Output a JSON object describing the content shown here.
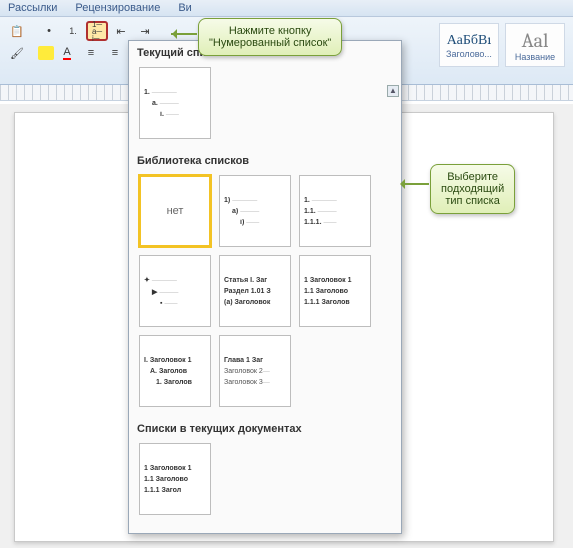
{
  "ribbon_tabs": [
    "Рассылки",
    "Рецензирование",
    "Ви"
  ],
  "callouts": {
    "press_button": {
      "line1": "Нажмите кнопку",
      "line2": "\"Нумерованный список\""
    },
    "choose_type": {
      "line1": "Выберите",
      "line2": "подходящий",
      "line3": "тип списка"
    }
  },
  "styles": {
    "s1": {
      "preview": "АаБбВı",
      "name": "Заголово..."
    },
    "s2": {
      "preview": "Aal",
      "name": "Название"
    }
  },
  "dropdown": {
    "section_current": "Текущий список",
    "section_library": "Библиотека списков",
    "section_docs": "Списки в текущих документах",
    "none_label": "нет",
    "current_tile": {
      "l1": "1.",
      "l2": "a.",
      "l3": "i."
    },
    "lib": {
      "r1c2": {
        "l1": "1)",
        "l2": "a)",
        "l3": "i)"
      },
      "r1c3": {
        "l1": "1.",
        "l2": "1.1.",
        "l3": "1.1.1."
      },
      "r2c1": {
        "l1": "✦",
        "l2": "▶",
        "l3": "▪"
      },
      "r2c2": {
        "l1": "Статья I. Заг",
        "l2": "Раздел 1.01 З",
        "l3": "(a) Заголовок"
      },
      "r2c3": {
        "l1": "1 Заголовок 1",
        "l2": "1.1 Заголово",
        "l3": "1.1.1 Заголов"
      },
      "r3c1": {
        "l1": "I. Заголовок 1",
        "l2": "A. Заголов",
        "l3": "1. Заголов"
      },
      "r3c2": {
        "l1": "Глава 1 Заг",
        "l2": "Заголовок 2",
        "l3": "Заголовок 3"
      }
    },
    "docs_tile": {
      "l1": "1 Заголовок 1",
      "l2": "1.1 Заголово",
      "l3": "1.1.1 Загол"
    }
  }
}
